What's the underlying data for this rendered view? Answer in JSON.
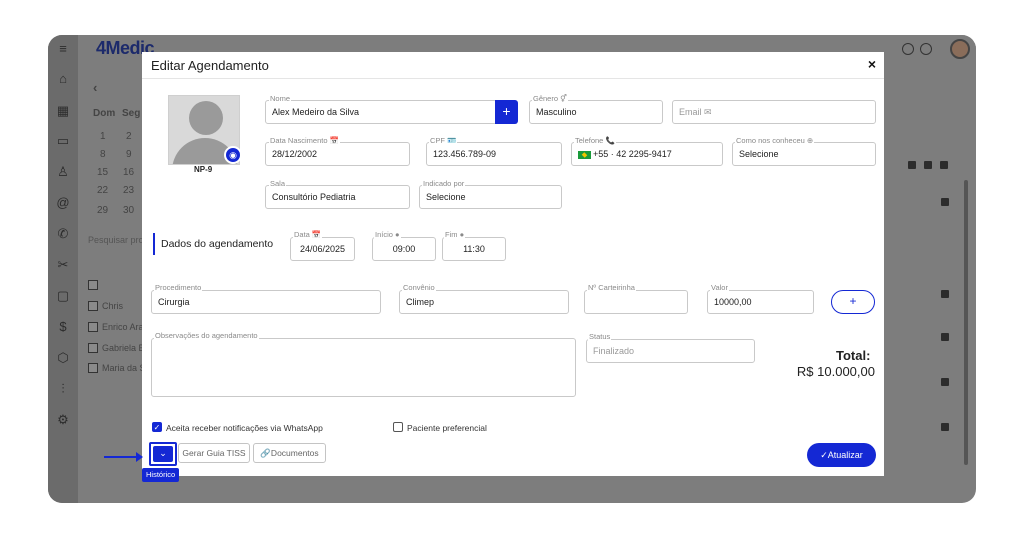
{
  "app": {
    "logo": "4Medic"
  },
  "background": {
    "calendar_nav": "‹",
    "calendar_days": [
      "Dom",
      "Seg"
    ],
    "calendar_rows": [
      [
        "1",
        "2"
      ],
      [
        "8",
        "9"
      ],
      [
        "15",
        "16"
      ],
      [
        "22",
        "23"
      ],
      [
        "29",
        "30"
      ]
    ],
    "search_placeholder": "Pesquisar pro",
    "professionals": [
      "Chris",
      "Enrico Ara",
      "Gabriela B",
      "Maria da S"
    ]
  },
  "modal": {
    "title": "Editar Agendamento",
    "close": "×",
    "photo_code": "NP-9",
    "fields": {
      "nome": {
        "label": "Nome",
        "value": "Alex Medeiro da Silva"
      },
      "genero": {
        "label": "Gênero ⚥",
        "value": "Masculino"
      },
      "email": {
        "placeholder": "Email ✉"
      },
      "data_nascimento": {
        "label": "Data Nascimento 📅",
        "value": "28/12/2002"
      },
      "cpf": {
        "label": "CPF 🪪",
        "value": "123.456.789-09"
      },
      "telefone": {
        "label": "Telefone 📞",
        "value": "+55 ·  42 2295-9417"
      },
      "como_conheceu": {
        "label": "Como nos conheceu ⊕",
        "value": "Selecione"
      },
      "sala": {
        "label": "Sala",
        "value": "Consultório Pediatria"
      },
      "indicado_por": {
        "label": "Indicado por",
        "value": "Selecione"
      }
    },
    "section_title": "Dados do agendamento",
    "agendamento": {
      "data": {
        "label": "Data 📅",
        "value": "24/06/2025"
      },
      "inicio": {
        "label": "Início ●",
        "value": "09:00"
      },
      "fim": {
        "label": "Fim ●",
        "value": "11:30"
      }
    },
    "procedimento": {
      "label": "Procedimento",
      "value": "Cirurgia"
    },
    "convenio": {
      "label": "Convênio",
      "value": "Climep"
    },
    "carteirinha": {
      "label": "Nº Carteirinha",
      "value": ""
    },
    "valor": {
      "label": "Valor",
      "value": "10000,00"
    },
    "add_button": "+",
    "observacoes": {
      "label": "Observações do agendamento",
      "value": ""
    },
    "status": {
      "label": "Status",
      "value": "Finalizado"
    },
    "total_label": "Total:",
    "total_value": "R$ 10.000,00",
    "whatsapp_label": "Aceita receber notificações via WhatsApp",
    "preferencial_label": "Paciente preferencial",
    "history_tooltip": "Histórico",
    "toggle_glyph": "⌄",
    "gerar_guia": "Gerar Guia TISS",
    "documentos": "🔗Documentos",
    "atualizar": "✓Atualizar"
  },
  "colors": {
    "accent": "#1428d4",
    "overlay": "#7d7d7d"
  }
}
